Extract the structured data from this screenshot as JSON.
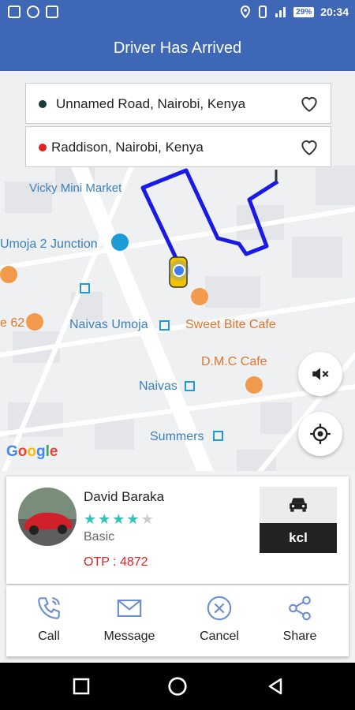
{
  "status_bar": {
    "time": "20:34",
    "battery": "29%"
  },
  "app_bar": {
    "title": "Driver Has Arrived"
  },
  "trip": {
    "pickup": {
      "address": "Unnamed Road, Nairobi, Kenya",
      "dot_color": "#1b3a3a"
    },
    "dropoff": {
      "address": "Raddison, Nairobi, Kenya",
      "dot_color": "#e02323"
    }
  },
  "map": {
    "labels": {
      "vicky": "Vicky Mini Market",
      "umoja2": "Umoja 2 Junction",
      "naivas_umoja": "Naivas Umoja",
      "sweet_bite": "Sweet Bite Cafe",
      "dmc": "D.M.C Cafe",
      "naivas": "Naivas",
      "summers": "Summers",
      "e62": "e 62"
    },
    "route_color": "#1a1ae6",
    "attribution": "Google"
  },
  "driver": {
    "name": "David  Baraka",
    "rating": 4,
    "rating_max": 5,
    "type": "Basic",
    "otp": "OTP : 4872",
    "vehicle_plate": "kcl"
  },
  "actions": [
    {
      "label": "Call",
      "icon": "phone-icon"
    },
    {
      "label": "Message",
      "icon": "mail-icon"
    },
    {
      "label": "Cancel",
      "icon": "cancel-icon"
    },
    {
      "label": "Share",
      "icon": "share-icon"
    }
  ],
  "colors": {
    "primary": "#3e67b5",
    "accent": "#2ec4b6",
    "otp": "#e02323"
  }
}
